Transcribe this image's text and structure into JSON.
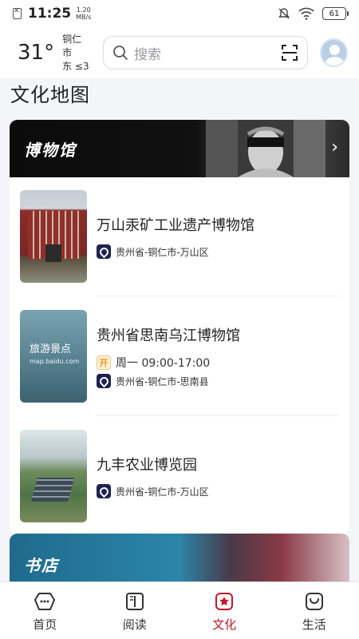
{
  "status_bar": {
    "time": "11:25",
    "net_speed": "1.20",
    "net_unit": "MB/s",
    "battery": "61"
  },
  "header": {
    "temperature": "31°",
    "city": "铜仁市",
    "wind": "东 ≤3",
    "search_placeholder": "搜索"
  },
  "page_title": "文化地图",
  "museum_section": {
    "banner_title": "博物馆",
    "items": [
      {
        "title": "万山汞矿工业遗产博物馆",
        "location": "贵州省-铜仁市-万山区"
      },
      {
        "title": "贵州省思南乌江博物馆",
        "hours_badge": "开",
        "hours": "周一 09:00-17:00",
        "location": "贵州省-铜仁市-思南县",
        "thumb_text": "旅游景点",
        "thumb_sub": "map.baidu.com"
      },
      {
        "title": "九丰农业博览园",
        "location": "贵州省-铜仁市-万山区"
      }
    ]
  },
  "bookstore_section": {
    "banner_title": "书店"
  },
  "tabbar": {
    "tabs": [
      {
        "label": "首页",
        "icon": "home-icon"
      },
      {
        "label": "阅读",
        "icon": "book-icon"
      },
      {
        "label": "文化",
        "icon": "culture-icon"
      },
      {
        "label": "生活",
        "icon": "bag-icon"
      }
    ],
    "active_index": 2,
    "active_color": "#c0182b"
  }
}
